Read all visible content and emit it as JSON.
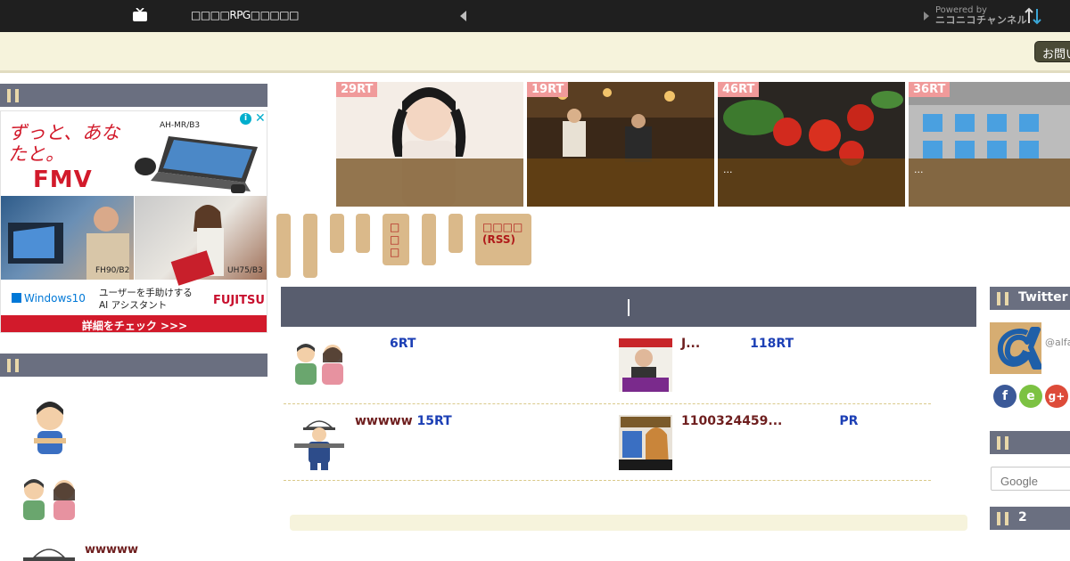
{
  "topbar": {
    "title": "□□□□RPG□□□□□",
    "powered_by": "Powered by",
    "powered_brand": "ニコニコチャンネル",
    "icons": [
      "tv-icon",
      "arrow-left-icon",
      "arrow-right-icon",
      "sort-arrows-icon"
    ]
  },
  "header": {
    "contact_label": "お問い"
  },
  "left_column": {
    "section1_title": "",
    "section2_title": "",
    "ad": {
      "tagline": "ずっと、あなたと。",
      "logo": "FMV",
      "model_1": "AH-MR/B3",
      "model_2": "FH90/B2",
      "model_3": "UH75/B3",
      "windows": "Windows10",
      "copy": "ユーザーを手助けする AI アシスタント",
      "maker": "FUJITSU",
      "cta": "詳細をチェック >>>",
      "info": "i",
      "close": "✕"
    },
    "items": [
      {
        "text": ""
      },
      {
        "text": ""
      },
      {
        "text": "wwwww"
      }
    ]
  },
  "ranking_cards": [
    {
      "rt": "29RT",
      "caption": ""
    },
    {
      "rt": "19RT",
      "caption": ""
    },
    {
      "rt": "46RT",
      "caption": "..."
    },
    {
      "rt": "36RT",
      "caption": "..."
    }
  ],
  "category_tabs": [
    {
      "label": ""
    },
    {
      "label": ""
    },
    {
      "label": ""
    },
    {
      "label": ""
    },
    {
      "label": "□□□"
    },
    {
      "label": ""
    },
    {
      "label": ""
    },
    {
      "label": "□□□□ (RSS)"
    }
  ],
  "main_list": {
    "entries": [
      {
        "title": "",
        "rt": "6RT"
      },
      {
        "title": "J...",
        "rt": "118RT"
      },
      {
        "title": "wwwww",
        "rt": "15RT"
      },
      {
        "title": "1100324459...",
        "rt": "PR"
      }
    ]
  },
  "right_column": {
    "twitter_title": "Twitter",
    "handle": "@alfa",
    "social": [
      "f",
      "e",
      "g+"
    ],
    "section_title": "",
    "search_placeholder": "Google",
    "bottom_title": "2"
  },
  "colors": {
    "topbar_bg": "#1f1f1f",
    "header_band": "#f6f3dc",
    "section_header": "#6a6f80",
    "main_header": "#585d6e",
    "tab_bg": "#dab98a",
    "rt_badge": "#f09a9a",
    "rt_text": "#1c3fb5",
    "title_text": "#6e1e1e"
  }
}
